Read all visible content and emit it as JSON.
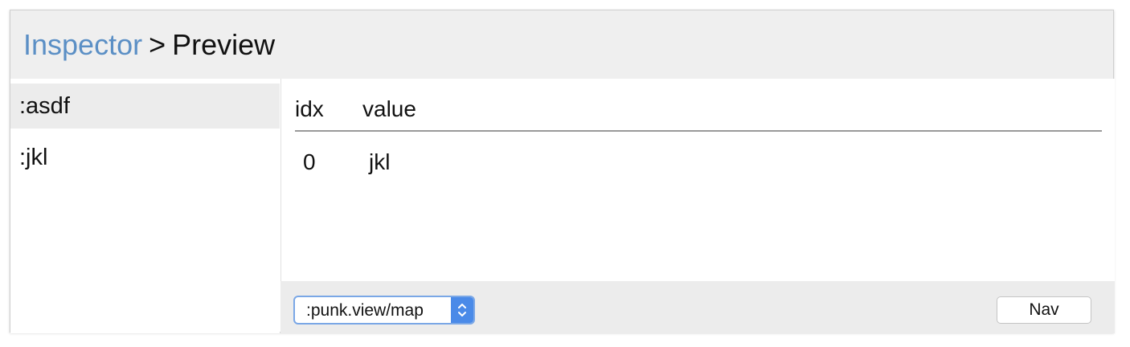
{
  "header": {
    "breadcrumb_link": "Inspector",
    "separator": ">",
    "current": "Preview"
  },
  "sidebar": {
    "items": [
      {
        "label": ":asdf",
        "selected": true
      },
      {
        "label": ":jkl",
        "selected": false
      }
    ]
  },
  "table": {
    "columns": [
      "idx",
      "value"
    ],
    "rows": [
      {
        "idx": "0",
        "value": "jkl"
      }
    ]
  },
  "footer": {
    "view_select_value": ":punk.view/map",
    "nav_button_label": "Nav"
  },
  "colors": {
    "link": "#5b8fc5",
    "select_accent": "#4a8ae8"
  },
  "icons": {
    "select_arrows": "up-down-chevron-icon"
  }
}
